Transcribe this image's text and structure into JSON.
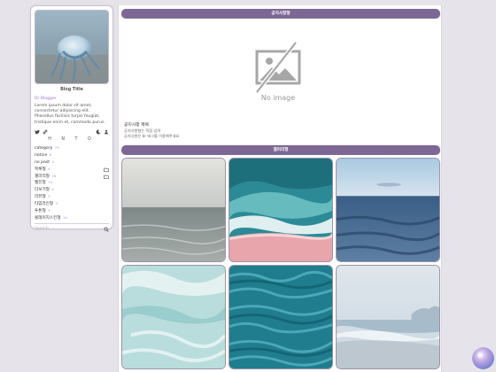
{
  "sidebar": {
    "blog_title": "Blog Title",
    "by_line": "Dr Blogger",
    "description": "Lorem ipsum dolor sit amet, consectetur adipiscing elit. Phasellus facilisis turpis feugiat, tristique enim et, commodo purus.",
    "hnto": "H N T O",
    "categories": [
      {
        "label": "category",
        "count": "79"
      },
      {
        "label": "notice",
        "count": "6"
      },
      {
        "label": "no post",
        "count": "0"
      },
      {
        "label": "목록형",
        "count": "4"
      },
      {
        "label": "갤러리형",
        "count": "16"
      },
      {
        "label": "웹진형",
        "count": "10"
      },
      {
        "label": "더보기형",
        "count": "4"
      },
      {
        "label": "리뷰형",
        "count": "3"
      },
      {
        "label": "타임라인형",
        "count": "3"
      },
      {
        "label": "투톤형",
        "count": "3"
      },
      {
        "label": "콜레이지스킨형",
        "count": "10"
      }
    ],
    "search_placeholder": "Search"
  },
  "notice_section": {
    "header": "공지사항형",
    "no_image_text": "No image",
    "post_title": "공지사항 제목",
    "post_desc_line1": "공지사항형는 직접 입력",
    "post_desc_line2": "공지사항은 br 태그를 이용해주세요"
  },
  "gallery_section": {
    "header": "갤러리형"
  },
  "colors": {
    "accent": "#7d6895",
    "count": "#b28cd8",
    "background": "#e6e3ea"
  }
}
